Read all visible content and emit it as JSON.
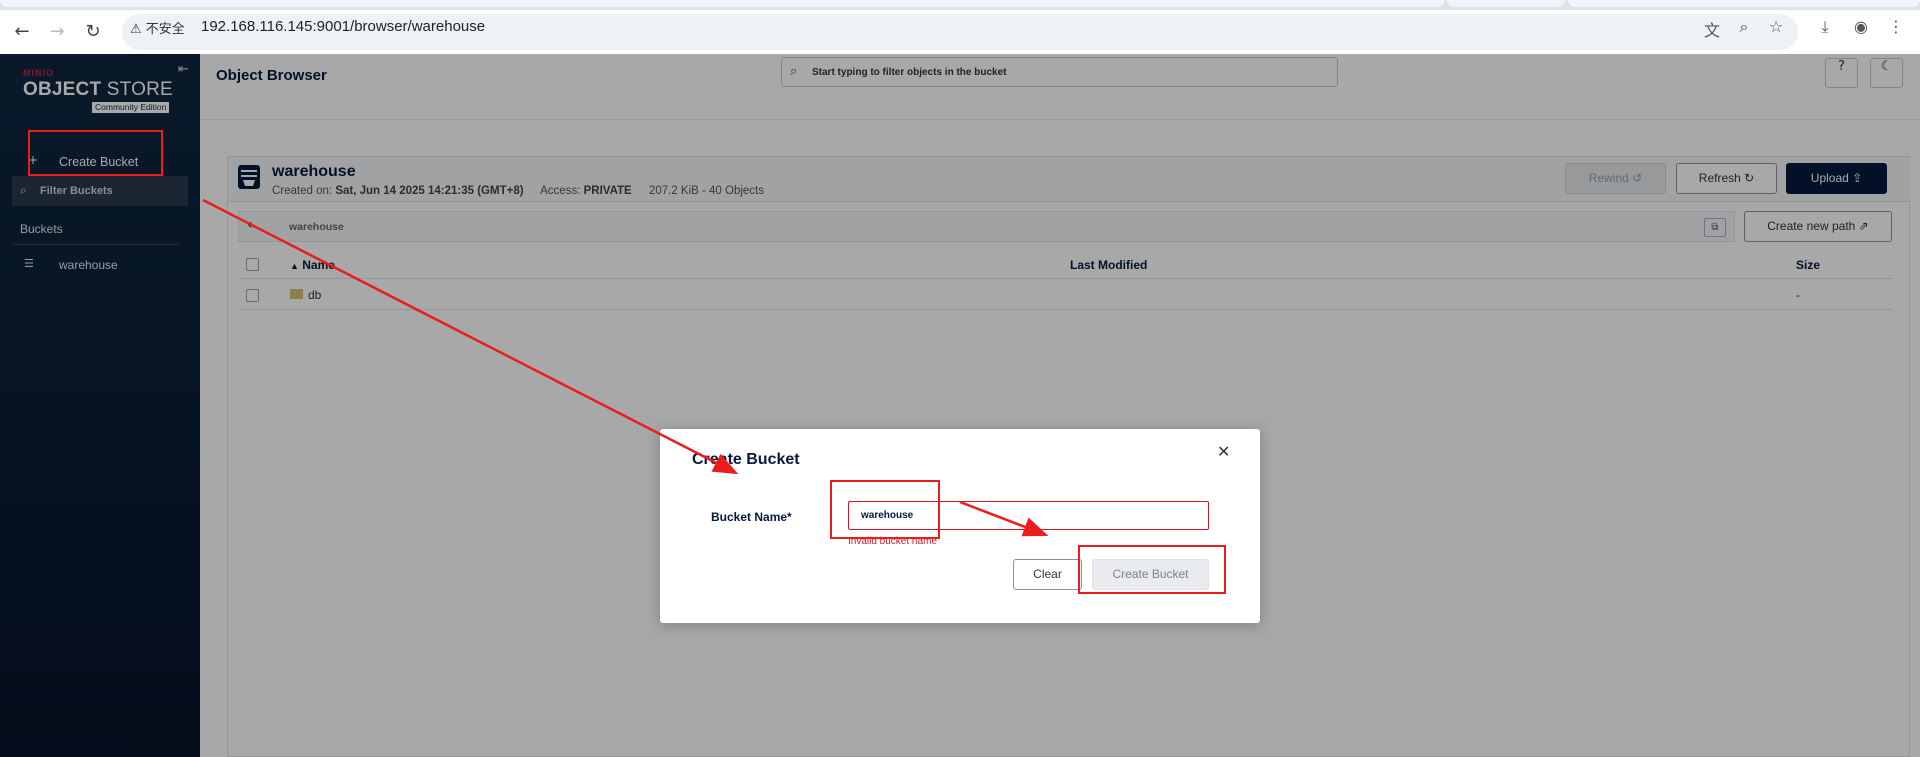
{
  "browser": {
    "not_secure_label": "不安全",
    "url": "192.168.116.145:9001/browser/warehouse",
    "back_icon": "←",
    "forward_icon": "→",
    "reload_icon": "↻"
  },
  "sidebar": {
    "logo_brand": "MINIO",
    "logo_object": "OBJECT",
    "logo_store": " STORE",
    "logo_edition": "Community Edition",
    "create_bucket_label": "Create Bucket",
    "filter_placeholder": "Filter Buckets",
    "buckets_heading": "Buckets",
    "bucket_items": [
      {
        "label": "warehouse"
      }
    ]
  },
  "header": {
    "title": "Object Browser",
    "search_placeholder": "Start typing to filter objects in the bucket"
  },
  "bucket": {
    "name": "warehouse",
    "created_label": "Created on:",
    "created_value": "Sat, Jun 14 2025 14:21:35 (GMT+8)",
    "access_label": "Access:",
    "access_value": "PRIVATE",
    "size_summary": "207.2 KiB - 40 Objects",
    "rewind_label": "Rewind",
    "refresh_label": "Refresh",
    "upload_label": "Upload"
  },
  "path": {
    "breadcrumb": "warehouse",
    "new_path_label": "Create new path"
  },
  "table": {
    "columns": {
      "name": "Name",
      "last_modified": "Last Modified",
      "size": "Size"
    },
    "rows": [
      {
        "name": "db",
        "last_modified": "",
        "size": "-"
      }
    ]
  },
  "modal": {
    "title": "Create Bucket",
    "field_label": "Bucket Name*",
    "field_value": "warehouse",
    "error_text": "Invalid bucket name",
    "clear_label": "Clear",
    "create_label": "Create Bucket"
  },
  "colors": {
    "sidebar_bg": "#0f2742",
    "primary": "#07193e",
    "error": "#c51b2e",
    "annotation": "#ea1c1c"
  }
}
